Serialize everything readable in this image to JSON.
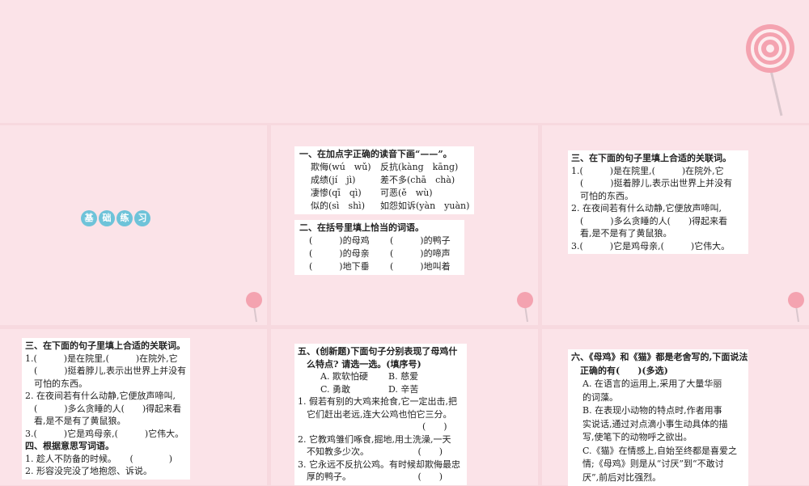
{
  "section_tag": [
    "基",
    "础",
    "练",
    "习"
  ],
  "q1": {
    "title": "一、在加点字正确的读音下画“——”。",
    "rows": [
      [
        "欺侮(wú　wǔ)",
        "反抗(kàng　kāng)"
      ],
      [
        "成绩(jí　jì)",
        "差不多(chā　chà)"
      ],
      [
        "凄惨(qī　qì)",
        "可恶(ě　wù)"
      ],
      [
        "似的(sì　shì)",
        "如怨如诉(yàn　yuàn)"
      ]
    ]
  },
  "q2": {
    "title": "二、在括号里填上恰当的词语。",
    "rows": [
      [
        "(　　　)的母鸡",
        "(　　　)的鸭子"
      ],
      [
        "(　　　)的母亲",
        "(　　　)的啼声"
      ],
      [
        "(　　　)地下垂",
        "(　　　)地叫着"
      ]
    ]
  },
  "q3": {
    "title": "三、在下面的句子里填上合适的关联词。",
    "lines": [
      "1.(　　　)是在院里,(　　　)在院外,它",
      "　(　　　)挺着脖儿,表示出世界上并没有",
      "　可怕的东西。",
      "2. 在夜间若有什么动静,它便放声啼叫,",
      "　(　　　)多么贪睡的人(　　)得起来看",
      "　看,是不是有了黄鼠狼。",
      "3.(　　　)它是鸡母亲,(　　　)它伟大。"
    ]
  },
  "q4": {
    "title": "四、根据意思写词语。",
    "lines": [
      "1. 趁人不防备的时候。　　(　　　　)",
      "2. 形容没完没了地抱怨、诉说。"
    ]
  },
  "q5": {
    "title_lines": [
      "五、(创新题)下面句子分别表现了母鸡什",
      "　么特点? 请选一选。(填序号)"
    ],
    "options": [
      [
        "A. 欺软怕硬",
        "B. 慈爱"
      ],
      [
        "C. 勇敢",
        "D. 辛苦"
      ]
    ],
    "lines": [
      "1. 假若有别的大鸡来抢食,它一定出击,把",
      "　它们赶出老远,连大公鸡也怕它三分。",
      "　　　　　　　　　　　　　　(　　)",
      "2. 它教鸡雏们啄食,掘地,用土洗澡,一天",
      "　不知教多少次。　　　　　　(　　)",
      "3. 它永远不反抗公鸡。有时候却欺侮最忠",
      "　厚的鸭子。　　　　　　　　(　　)"
    ]
  },
  "q6": {
    "title_lines": [
      "六、《母鸡》和《猫》都是老舍写的,下面说法",
      "　正确的有(　　)(多选)"
    ],
    "lines": [
      "A. 在语言的运用上,采用了大量华丽",
      "的词藻。",
      "B. 在表现小动物的特点时,作者用事",
      "实说话,通过对点滴小事生动具体的描",
      "写,使笔下的动物呼之欲出。",
      "C.《猫》在情感上,自始至终都是喜爱之",
      "情;《母鸡》则是从“讨厌”到“不敢讨",
      "厌”,前后对比强烈。"
    ]
  }
}
